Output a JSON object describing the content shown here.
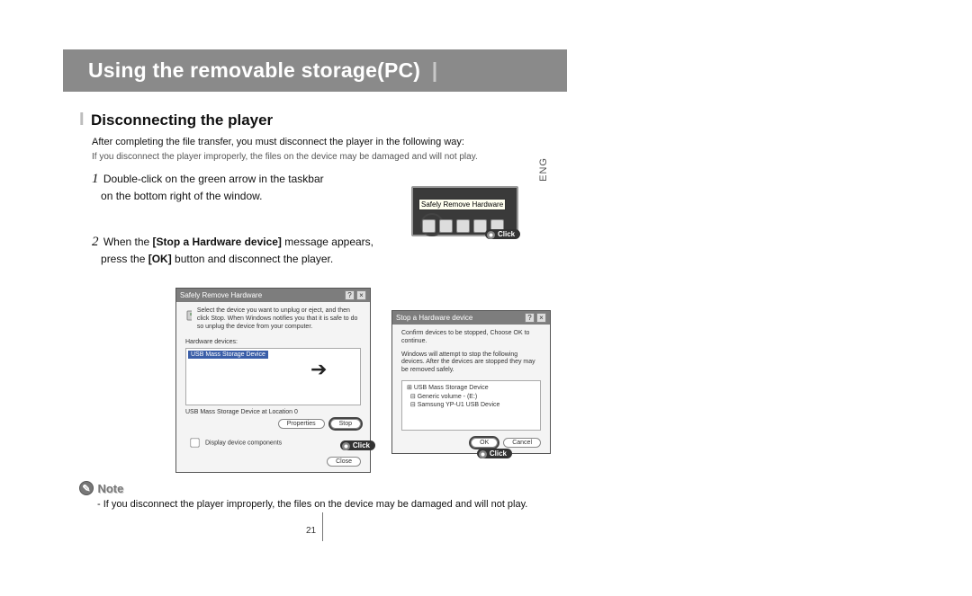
{
  "header": {
    "title": "Using the removable storage(PC)"
  },
  "section": {
    "title": "Disconnecting the player"
  },
  "intro": {
    "line1": "After completing the file transfer, you must disconnect the player in the following way:",
    "warning": "If you disconnect the player improperly, the files on the device may be damaged and will not play."
  },
  "steps": {
    "s1": {
      "num": "1",
      "text_a": "Double-click on the green arrow in the taskbar",
      "text_b": "on the bottom right of the window."
    },
    "s2": {
      "num": "2",
      "text_a": "When the ",
      "bold_a": "[Stop a Hardware device]",
      "text_b": " message appears,",
      "text_c": "press the ",
      "bold_b": "[OK]",
      "text_d": " button and disconnect the player."
    }
  },
  "tray_tooltip": "Safely Remove Hardware",
  "click_label": "Click",
  "dialog1": {
    "title": "Safely Remove Hardware",
    "msg": "Select the device you want to unplug or eject, and then click Stop. When Windows notifies you that it is safe to do so unplug the device from your computer.",
    "label_devices": "Hardware devices:",
    "selected": "USB Mass Storage Device",
    "status": "USB Mass Storage Device at Location 0",
    "btn_properties": "Properties",
    "btn_stop": "Stop",
    "check_label": "Display device components",
    "btn_close": "Close"
  },
  "dialog2": {
    "title": "Stop a Hardware device",
    "msg1": "Confirm devices to be stopped, Choose OK to continue.",
    "msg2": "Windows will attempt to stop the following devices. After the devices are stopped they may be removed safely.",
    "item1": "USB Mass Storage Device",
    "item2": "Generic volume - (E:)",
    "item3": "Samsung YP-U1 USB Device",
    "btn_ok": "OK",
    "btn_cancel": "Cancel"
  },
  "note": {
    "heading": "Note",
    "bullet": "- If you disconnect the player improperly, the files on the device may be damaged and will not play."
  },
  "page_number": "21",
  "lang_tab": "ENG"
}
